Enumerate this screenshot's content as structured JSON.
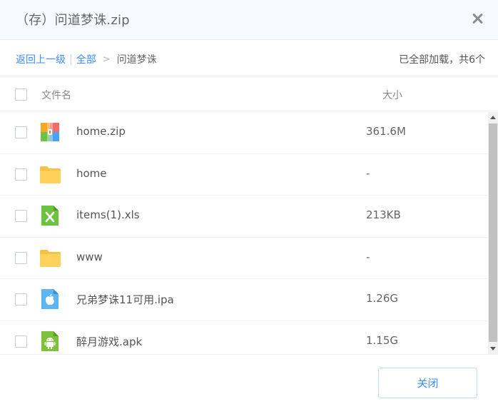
{
  "dialog": {
    "title": "（存）问道梦诛.zip"
  },
  "breadcrumb": {
    "back_label": "返回上一级",
    "separator": "|",
    "all_label": "全部",
    "arrow": ">",
    "current": "问道梦诛"
  },
  "status": {
    "loaded_text": "已全部加载，共6个"
  },
  "table": {
    "headers": {
      "name": "文件名",
      "size": "大小"
    },
    "rows": [
      {
        "name": "home.zip",
        "size": "361.6M",
        "icon": "zip-archive-icon"
      },
      {
        "name": "home",
        "size": "-",
        "icon": "folder-icon"
      },
      {
        "name": "items(1).xls",
        "size": "213KB",
        "icon": "excel-file-icon"
      },
      {
        "name": "www",
        "size": "-",
        "icon": "folder-icon"
      },
      {
        "name": "兄弟梦诛11可用.ipa",
        "size": "1.26G",
        "icon": "ios-app-icon"
      },
      {
        "name": "醉月游戏.apk",
        "size": "1.15G",
        "icon": "android-app-icon"
      }
    ]
  },
  "footer": {
    "close_label": "关闭"
  },
  "colors": {
    "accent": "#3b8cff",
    "folder": "#ffd25c",
    "excel": "#6cc33f",
    "ios": "#5fb5f4",
    "android": "#7dc23a"
  }
}
